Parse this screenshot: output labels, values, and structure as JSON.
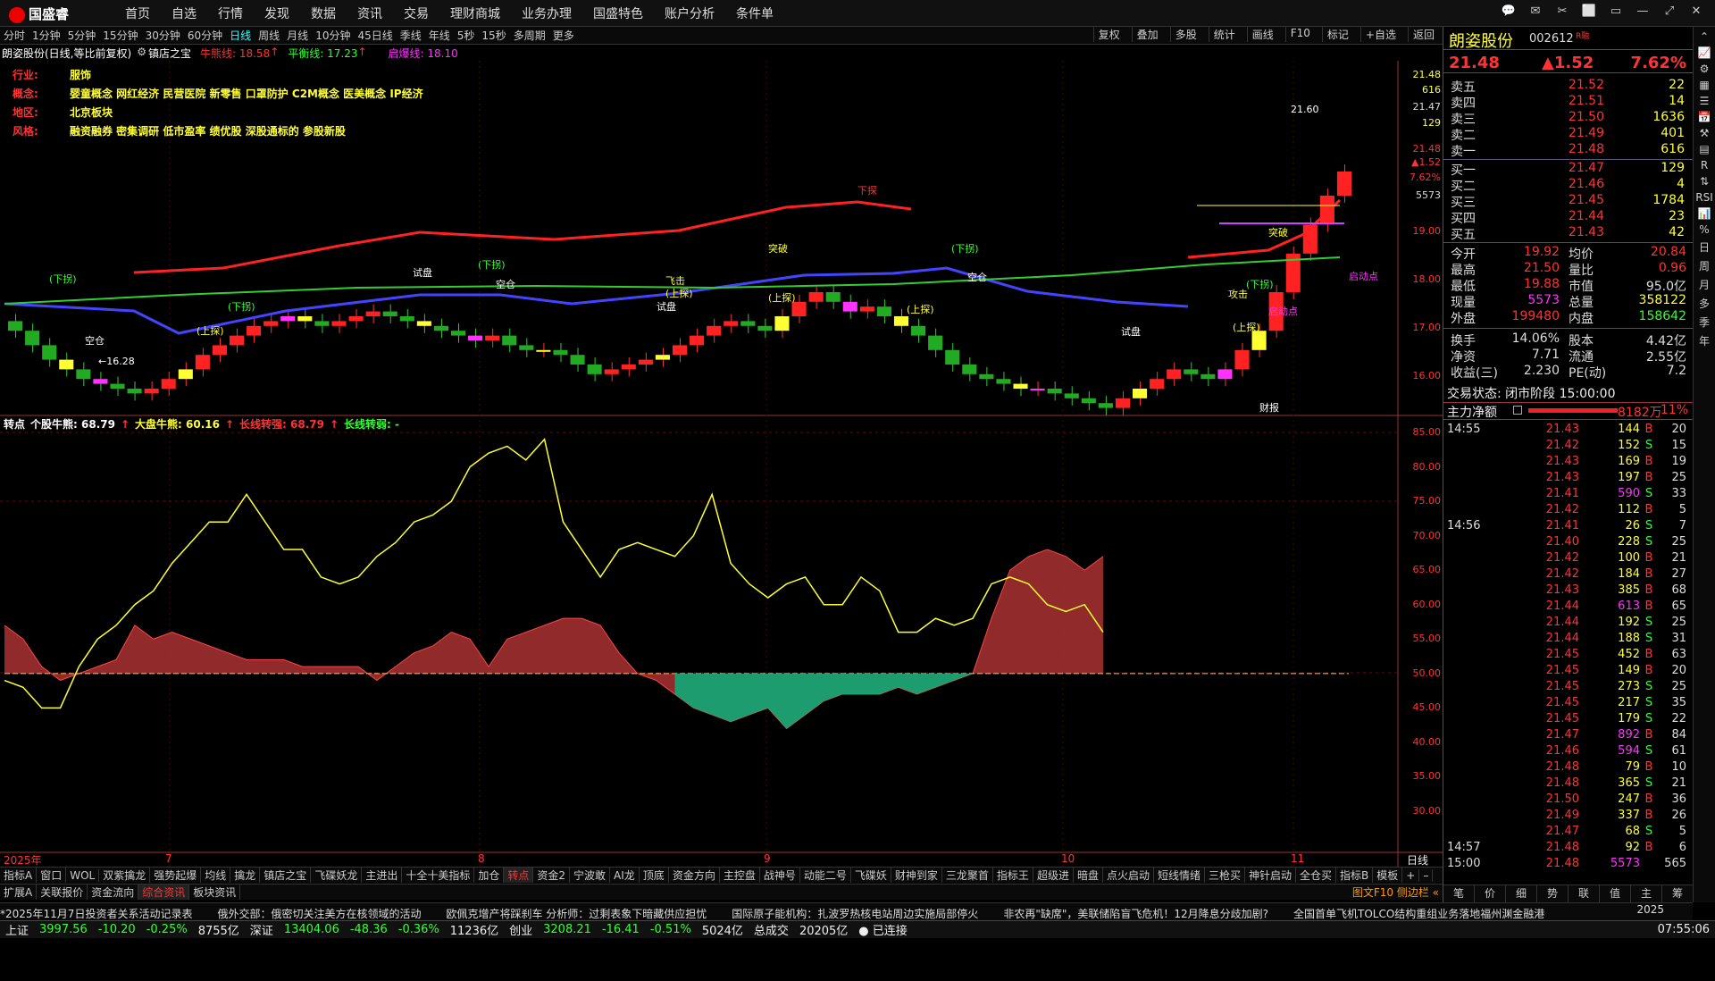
{
  "app": {
    "logo": "国盛睿"
  },
  "nav": [
    "首页",
    "自选",
    "行情",
    "发现",
    "数据",
    "资讯",
    "交易",
    "理财商城",
    "业务办理",
    "国盛特色",
    "账户分析",
    "条件单"
  ],
  "window_buttons": [
    "💬",
    "✉",
    "✂",
    "⬜",
    "▭",
    "—",
    "⤢",
    "✕"
  ],
  "periods": [
    "分时",
    "1分钟",
    "5分钟",
    "15分钟",
    "30分钟",
    "60分钟",
    "日线",
    "周线",
    "月线",
    "10分钟",
    "45日线",
    "季线",
    "年线",
    "5秒",
    "15秒",
    "多周期",
    "更多"
  ],
  "period_active": "日线",
  "right_tools": [
    "复权",
    "叠加",
    "多股",
    "统计",
    "画线",
    "F10",
    "标记",
    "+自选",
    "返回"
  ],
  "chart_head": {
    "title": "朗姿股份(日线,等比前复权)",
    "indicator": "镇店之宝",
    "bull": "牛熊线: 18.58",
    "bull_arrow": "↑",
    "balance": "平衡线: 17.23",
    "balance_arrow": "↑",
    "launch": "启爆线: 18.10"
  },
  "info": [
    {
      "k": "行业:",
      "v": "服饰"
    },
    {
      "k": "概念:",
      "v": "婴童概念 网红经济 民营医院 新零售 口罩防护 C2M概念 医美概念 IP经济"
    },
    {
      "k": "地区:",
      "v": "北京板块"
    },
    {
      "k": "风格:",
      "v": "融资融券 密集调研 低市盈率 绩优股 深股通标的 参股新股"
    }
  ],
  "main_chart": {
    "y_labels": [
      {
        "v": "21.48",
        "c": "#ff3"
      },
      {
        "v": "616",
        "c": "#ff3"
      },
      {
        "v": "21.47",
        "c": "#ddd"
      },
      {
        "v": "129",
        "c": "#ff3"
      },
      {
        "v": "21.48",
        "c": "#f33"
      },
      {
        "v": "▲1.52",
        "c": "#f33"
      },
      {
        "v": "7.62%",
        "c": "#f33"
      },
      {
        "v": "5573",
        "c": "#ddd"
      },
      {
        "v": "19.00",
        "c": "#f33"
      },
      {
        "v": "18.00",
        "c": "#f33"
      },
      {
        "v": "17.00",
        "c": "#f33"
      },
      {
        "v": "16.00",
        "c": "#f33"
      }
    ],
    "labels": [
      {
        "t": "(下拐)",
        "c": "#3f3"
      },
      {
        "t": "(下拐)",
        "c": "#3f3"
      },
      {
        "t": "(下拐)",
        "c": "#3f3"
      },
      {
        "t": "(下拐)",
        "c": "#3f3"
      },
      {
        "t": "(上探)",
        "c": "#ff3"
      },
      {
        "t": "(上探)",
        "c": "#ff3"
      },
      {
        "t": "(上探)",
        "c": "#ff3"
      },
      {
        "t": "(上探)",
        "c": "#ff3"
      },
      {
        "t": "(上探)",
        "c": "#ff3"
      },
      {
        "t": "空仓",
        "c": "#fff"
      },
      {
        "t": "空仓",
        "c": "#fff"
      },
      {
        "t": "空仓",
        "c": "#fff"
      },
      {
        "t": "试盘",
        "c": "#fff"
      },
      {
        "t": "试盘",
        "c": "#fff"
      },
      {
        "t": "试盘",
        "c": "#fff"
      },
      {
        "t": "下探",
        "c": "#f33"
      },
      {
        "t": "突破",
        "c": "#ff3"
      },
      {
        "t": "突破",
        "c": "#ff3"
      },
      {
        "t": "飞击",
        "c": "#ff3"
      },
      {
        "t": "攻击",
        "c": "#ff3"
      },
      {
        "t": "启动点",
        "c": "#f3f"
      },
      {
        "t": "启动点",
        "c": "#f3f"
      },
      {
        "t": "财报",
        "c": "#fff"
      },
      {
        "t": "21.60",
        "c": "#fff"
      },
      {
        "t": "←16.28",
        "c": "#fff"
      },
      {
        "t": "(下拐)",
        "c": "#3f3"
      }
    ]
  },
  "sub_chart": {
    "head": [
      {
        "t": "转点",
        "c": "#fff"
      },
      {
        "t": "个股牛熊: 68.79",
        "c": "#fff"
      },
      {
        "t": "↑",
        "c": "#f33"
      },
      {
        "t": "大盘牛熊: 60.16",
        "c": "#ff3"
      },
      {
        "t": "↑",
        "c": "#f33"
      },
      {
        "t": "长线转强: 68.79",
        "c": "#f33"
      },
      {
        "t": "↑",
        "c": "#f33"
      },
      {
        "t": "长线转弱: -",
        "c": "#3f3"
      }
    ],
    "y_labels": [
      "85.00",
      "80.00",
      "75.00",
      "70.00",
      "65.00",
      "60.00",
      "55.00",
      "50.00",
      "45.00",
      "40.00",
      "35.00",
      "30.00"
    ]
  },
  "x_axis": {
    "labels": [
      "2025年",
      "7",
      "8",
      "9",
      "10",
      "11"
    ],
    "right": "日线"
  },
  "tabs1": [
    "指标A",
    "窗口",
    "WOL",
    "双紫擒龙",
    "强势起爆",
    "均线",
    "擒龙",
    "镇店之宝",
    "飞碟妖龙",
    "主进出",
    "十全十美指标",
    "加仓",
    "转点",
    "资金2",
    "宁波敢",
    "AI龙",
    "顶底",
    "资金方向",
    "主控盘",
    "战神号",
    "动能二号",
    "飞碟妖",
    "财神到家",
    "三龙聚首",
    "指标王",
    "超级进",
    "暗盘",
    "点火启动",
    "短线情绪",
    "三枪买",
    "神针启动",
    "全仓买",
    "指标B",
    "模板",
    "+",
    "–"
  ],
  "tabs1_active": "转点",
  "tabs2": [
    "扩展A",
    "关联报价",
    "资金流向",
    "综合资讯",
    "板块资讯"
  ],
  "tabs2_active": "综合资讯",
  "tabs2_right": "图文F10 侧边栏 «",
  "quote": {
    "name": "朗姿股份",
    "code": "002612",
    "mark": "R融",
    "price": "21.48",
    "change": "▲1.52",
    "pct": "7.62%",
    "asks": [
      {
        "l": "卖五",
        "p": "21.52",
        "q": "22"
      },
      {
        "l": "卖四",
        "p": "21.51",
        "q": "14"
      },
      {
        "l": "卖三",
        "p": "21.50",
        "q": "1636"
      },
      {
        "l": "卖二",
        "p": "21.49",
        "q": "401"
      },
      {
        "l": "卖一",
        "p": "21.48",
        "q": "616"
      }
    ],
    "bids": [
      {
        "l": "买一",
        "p": "21.47",
        "q": "129"
      },
      {
        "l": "买二",
        "p": "21.46",
        "q": "4"
      },
      {
        "l": "买三",
        "p": "21.45",
        "q": "1784"
      },
      {
        "l": "买四",
        "p": "21.44",
        "q": "23"
      },
      {
        "l": "买五",
        "p": "21.43",
        "q": "42"
      }
    ],
    "stats": [
      {
        "a": "今开",
        "b": "19.92",
        "bc": "#f33",
        "c": "均价",
        "d": "20.84",
        "dc": "#f33"
      },
      {
        "a": "最高",
        "b": "21.50",
        "bc": "#f33",
        "c": "量比",
        "d": "0.96",
        "dc": "#f33"
      },
      {
        "a": "最低",
        "b": "19.88",
        "bc": "#f33",
        "c": "市值",
        "d": "95.0亿",
        "dc": "#ddd"
      },
      {
        "a": "现量",
        "b": "5573",
        "bc": "#f3f",
        "c": "总量",
        "d": "358122",
        "dc": "#ff3"
      },
      {
        "a": "外盘",
        "b": "199480",
        "bc": "#f33",
        "c": "内盘",
        "d": "158642",
        "dc": "#3f3"
      }
    ],
    "stats2": [
      {
        "a": "换手",
        "b": "14.06%",
        "c": "股本",
        "d": "4.42亿"
      },
      {
        "a": "净资",
        "b": "7.71",
        "c": "流通",
        "d": "2.55亿"
      },
      {
        "a": "收益(三)",
        "b": "2.230",
        "c": "PE(动)",
        "d": "7.2"
      }
    ],
    "trade_state": "交易状态: 闭市阶段 15:00:00",
    "net_label": "主力净额",
    "net_value": "8182万",
    "net_pct": "11%"
  },
  "ticks": [
    {
      "t": "14:55",
      "p": "21.43",
      "q": "144",
      "d": "B",
      "n": "20"
    },
    {
      "t": "",
      "p": "21.42",
      "q": "152",
      "d": "S",
      "n": "15"
    },
    {
      "t": "",
      "p": "21.43",
      "q": "169",
      "d": "B",
      "n": "19"
    },
    {
      "t": "",
      "p": "21.43",
      "q": "197",
      "d": "B",
      "n": "25"
    },
    {
      "t": "",
      "p": "21.41",
      "q": "590",
      "d": "S",
      "n": "33"
    },
    {
      "t": "",
      "p": "21.42",
      "q": "112",
      "d": "B",
      "n": "5"
    },
    {
      "t": "14:56",
      "p": "21.41",
      "q": "26",
      "d": "S",
      "n": "7"
    },
    {
      "t": "",
      "p": "21.40",
      "q": "228",
      "d": "S",
      "n": "25"
    },
    {
      "t": "",
      "p": "21.42",
      "q": "100",
      "d": "B",
      "n": "21"
    },
    {
      "t": "",
      "p": "21.42",
      "q": "184",
      "d": "B",
      "n": "27"
    },
    {
      "t": "",
      "p": "21.43",
      "q": "385",
      "d": "B",
      "n": "68"
    },
    {
      "t": "",
      "p": "21.44",
      "q": "613",
      "d": "B",
      "n": "65"
    },
    {
      "t": "",
      "p": "21.44",
      "q": "192",
      "d": "S",
      "n": "25"
    },
    {
      "t": "",
      "p": "21.44",
      "q": "188",
      "d": "S",
      "n": "31"
    },
    {
      "t": "",
      "p": "21.45",
      "q": "452",
      "d": "B",
      "n": "63"
    },
    {
      "t": "",
      "p": "21.45",
      "q": "149",
      "d": "B",
      "n": "20"
    },
    {
      "t": "",
      "p": "21.45",
      "q": "273",
      "d": "S",
      "n": "25"
    },
    {
      "t": "",
      "p": "21.45",
      "q": "217",
      "d": "S",
      "n": "35"
    },
    {
      "t": "",
      "p": "21.45",
      "q": "179",
      "d": "S",
      "n": "22"
    },
    {
      "t": "",
      "p": "21.47",
      "q": "892",
      "d": "B",
      "n": "84"
    },
    {
      "t": "",
      "p": "21.46",
      "q": "594",
      "d": "S",
      "n": "61"
    },
    {
      "t": "",
      "p": "21.48",
      "q": "79",
      "d": "B",
      "n": "10"
    },
    {
      "t": "",
      "p": "21.48",
      "q": "365",
      "d": "S",
      "n": "21"
    },
    {
      "t": "",
      "p": "21.50",
      "q": "247",
      "d": "B",
      "n": "36"
    },
    {
      "t": "",
      "p": "21.49",
      "q": "337",
      "d": "B",
      "n": "26"
    },
    {
      "t": "",
      "p": "21.47",
      "q": "68",
      "d": "S",
      "n": "5"
    },
    {
      "t": "14:57",
      "p": "21.48",
      "q": "92",
      "d": "B",
      "n": "6"
    },
    {
      "t": "15:00",
      "p": "21.48",
      "q": "5573",
      "d": "",
      "n": "565"
    }
  ],
  "rp_tabs": [
    "笔",
    "价",
    "细",
    "势",
    "联",
    "值",
    "主",
    "筹"
  ],
  "sidebar": [
    "⌃",
    "📈",
    "⚙",
    "▦",
    "☰",
    "📅",
    "⚒",
    "▤",
    "R",
    "⇅",
    "RSI",
    "📊",
    "%",
    "日",
    "周",
    "月",
    "多",
    "季",
    "年"
  ],
  "news": [
    "*2025年11月7日投资者关系活动记录表",
    "俄外交部：俄密切关注美方在核领域的活动",
    "欧佩克增产将踩刹车 分析师：过剩表象下暗藏供应担忧",
    "国际原子能机构：扎波罗热核电站周边实施局部停火",
    "非农再\"缺席\"，美联储陷盲飞危机！12月降息分歧加剧?",
    "全国首单飞机TOLCO结构重组业务落地福州渊金融港"
  ],
  "status": [
    {
      "t": "上证",
      "c": "#eee"
    },
    {
      "t": "3997.56",
      "c": "#3f3"
    },
    {
      "t": "-10.20",
      "c": "#3f3"
    },
    {
      "t": "-0.25%",
      "c": "#3f3"
    },
    {
      "t": "8755亿",
      "c": "#eee"
    },
    {
      "t": "深证",
      "c": "#eee"
    },
    {
      "t": "13404.06",
      "c": "#3f3"
    },
    {
      "t": "-48.36",
      "c": "#3f3"
    },
    {
      "t": "-0.36%",
      "c": "#3f3"
    },
    {
      "t": "11236亿",
      "c": "#eee"
    },
    {
      "t": "创业",
      "c": "#eee"
    },
    {
      "t": "3208.21",
      "c": "#3f3"
    },
    {
      "t": "-16.41",
      "c": "#3f3"
    },
    {
      "t": "-0.51%",
      "c": "#3f3"
    },
    {
      "t": "5024亿",
      "c": "#eee"
    },
    {
      "t": "总成交",
      "c": "#eee"
    },
    {
      "t": "20205亿",
      "c": "#eee"
    },
    {
      "t": "● 已连接",
      "c": "#eee"
    }
  ],
  "status_right": "07:55:06",
  "year_right": "2025"
}
